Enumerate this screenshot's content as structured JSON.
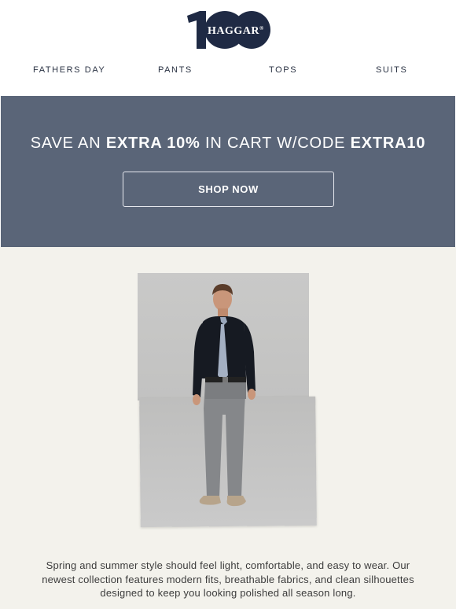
{
  "header": {
    "logo_number": "100",
    "logo_brand": "HAGGAR",
    "logo_mark": "®",
    "nav": [
      {
        "label": "FATHERS DAY"
      },
      {
        "label": "PANTS"
      },
      {
        "label": "TOPS"
      },
      {
        "label": "SUITS"
      }
    ]
  },
  "banner": {
    "prefix": "SAVE AN ",
    "extra": "EXTRA 10%",
    "middle": " IN CART W/CODE ",
    "code": "EXTRA10",
    "button_label": "SHOP NOW",
    "background_color": "#5a6578"
  },
  "product": {
    "image": "model-in-black-shirt-tie-and-grey-pants-photo",
    "description": "Spring and summer style should feel light, comfortable, and easy to wear. Our newest collection features modern fits, breathable fabrics, and clean silhouettes designed to keep you looking polished all season long."
  },
  "colors": {
    "brand_navy": "#1f2a44",
    "section_background": "#f3f2ec"
  }
}
